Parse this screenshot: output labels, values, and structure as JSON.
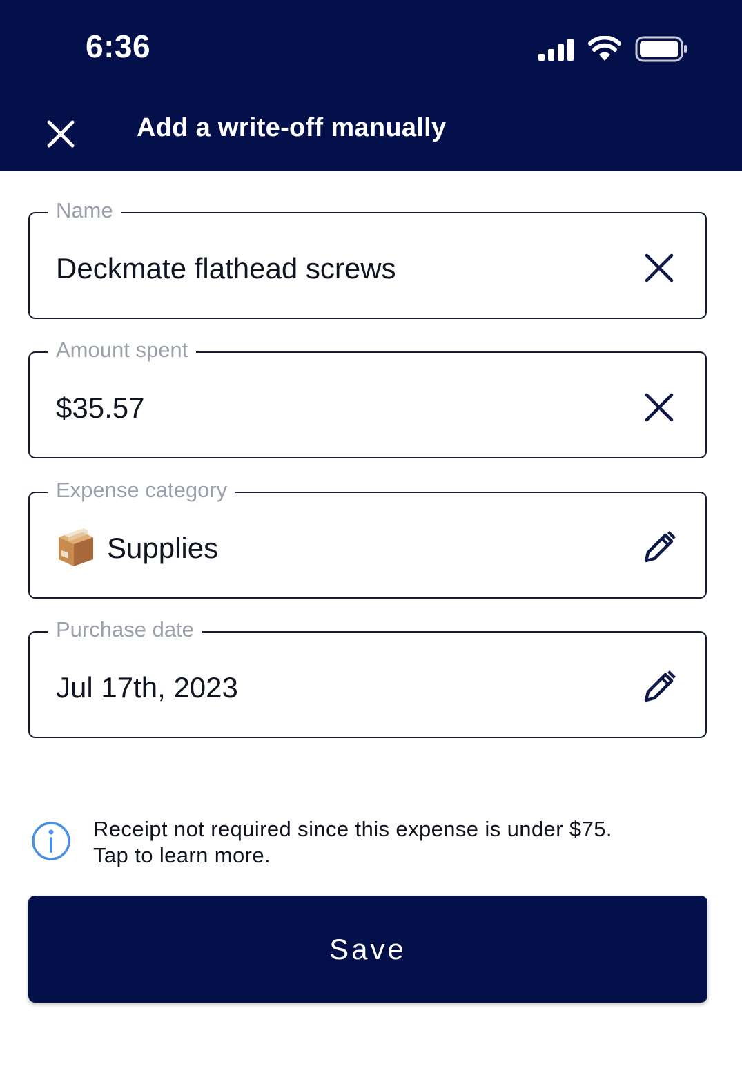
{
  "status_bar": {
    "time": "6:36"
  },
  "header": {
    "title": "Add a write-off manually",
    "close_icon": "close-icon",
    "background": "#03104a"
  },
  "form": {
    "name": {
      "label": "Name",
      "value": "Deckmate flathead screws",
      "action_icon": "clear-icon"
    },
    "amount": {
      "label": "Amount spent",
      "value": "$35.57",
      "action_icon": "clear-icon"
    },
    "category": {
      "label": "Expense category",
      "value": "Supplies",
      "emoji": "package-box-emoji",
      "action_icon": "pencil-icon"
    },
    "date": {
      "label": "Purchase date",
      "value": "Jul 17th, 2023",
      "action_icon": "pencil-icon"
    }
  },
  "info": {
    "icon": "info-icon",
    "line1": "Receipt not required since this expense is under $75.",
    "line2": "Tap to learn more.",
    "icon_color": "#4a90e2"
  },
  "save_button": {
    "label": "Save",
    "background": "#03104a"
  }
}
